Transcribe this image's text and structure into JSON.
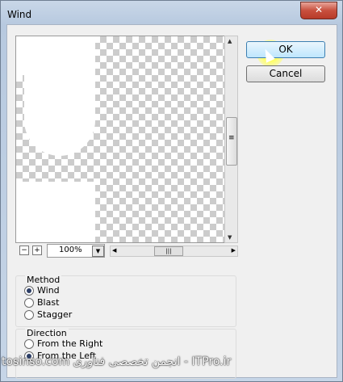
{
  "window": {
    "title": "Wind",
    "close_glyph": "✕"
  },
  "preview": {
    "zoom_value": "100%",
    "zoom_out": "−",
    "zoom_in": "+",
    "dropdown_glyph": "▼",
    "vscroll_up": "▲",
    "vscroll_down": "▼",
    "vscroll_grip": "≡",
    "hscroll_left": "◀",
    "hscroll_right": "▶",
    "hscroll_grip": "|||"
  },
  "buttons": {
    "ok": "OK",
    "cancel": "Cancel"
  },
  "method": {
    "label": "Method",
    "options": [
      {
        "label": "Wind",
        "selected": true
      },
      {
        "label": "Blast",
        "selected": false
      },
      {
        "label": "Stagger",
        "selected": false
      }
    ]
  },
  "direction": {
    "label": "Direction",
    "options": [
      {
        "label": "From the Right",
        "selected": false
      },
      {
        "label": "From the Left",
        "selected": true
      }
    ]
  },
  "watermark": "tosinso.com انجمن تخصصی فناوری - ITPro.ir",
  "colors": {
    "accent": "#3c7fb1",
    "close": "#c8503e"
  }
}
